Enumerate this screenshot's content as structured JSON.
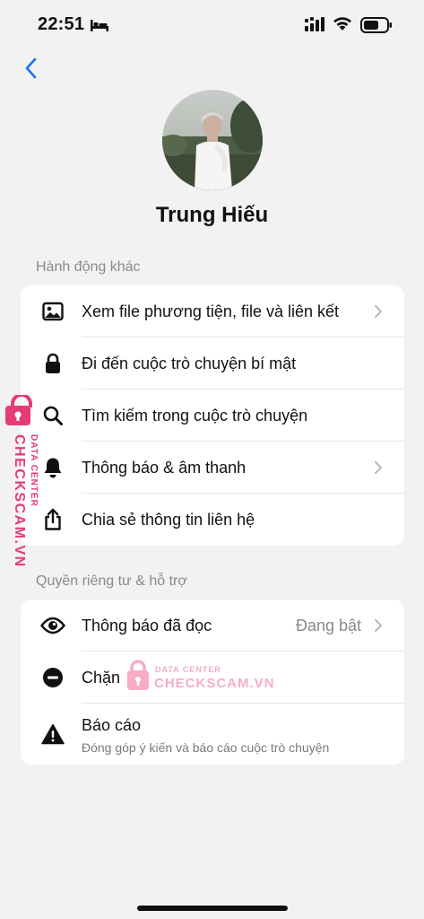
{
  "status_bar": {
    "time": "22:51"
  },
  "profile": {
    "name": "Trung Hiếu"
  },
  "sections": {
    "other_actions": {
      "title": "Hành động khác",
      "items": [
        {
          "label": "Xem file phương tiện, file và liên kết",
          "icon": "image-icon",
          "chevron": true
        },
        {
          "label": "Đi đến cuộc trò chuyện bí mật",
          "icon": "lock-icon",
          "chevron": false
        },
        {
          "label": "Tìm kiếm trong cuộc trò chuyện",
          "icon": "search-icon",
          "chevron": false
        },
        {
          "label": "Thông báo & âm thanh",
          "icon": "bell-icon",
          "chevron": true
        },
        {
          "label": "Chia sẻ thông tin liên hệ",
          "icon": "share-icon",
          "chevron": false
        }
      ]
    },
    "privacy_support": {
      "title": "Quyền riêng tư & hỗ trợ",
      "items": [
        {
          "label": "Thông báo đã đọc",
          "value": "Đang bật",
          "icon": "eye-icon",
          "chevron": true
        },
        {
          "label": "Chặn",
          "icon": "block-icon",
          "chevron": false
        },
        {
          "label": "Báo cáo",
          "subtitle": "Đóng góp ý kiến và báo cáo cuộc trò chuyện",
          "icon": "warning-icon",
          "chevron": false
        }
      ]
    }
  },
  "watermark": {
    "vertical_main": "CHECKSCAM.VN",
    "vertical_sub": "DATA CENTER",
    "center_main": "CHECKSCAM.VN",
    "center_sub": "DATA CENTER"
  },
  "colors": {
    "accent": "#1a73e8",
    "watermark": "#e63c76",
    "background": "#f2f2f2"
  }
}
